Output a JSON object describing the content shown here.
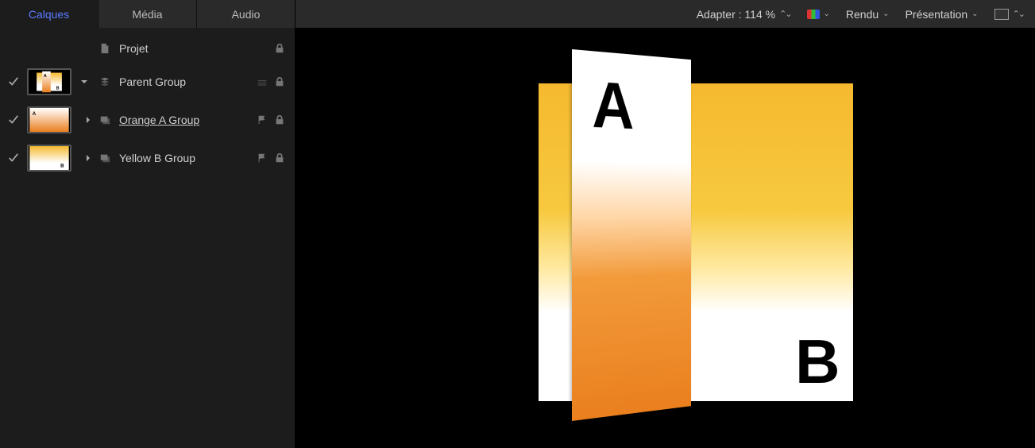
{
  "tabs": [
    "Calques",
    "Média",
    "Audio"
  ],
  "layers": {
    "project": "Projet",
    "parent": "Parent Group",
    "orangeA": "Orange A Group",
    "yellowB": "Yellow B Group"
  },
  "toolbar": {
    "fit_label": "Adapter : 114 %",
    "render": "Rendu",
    "view": "Présentation"
  },
  "canvas": {
    "letterA": "A",
    "letterB": "B"
  }
}
